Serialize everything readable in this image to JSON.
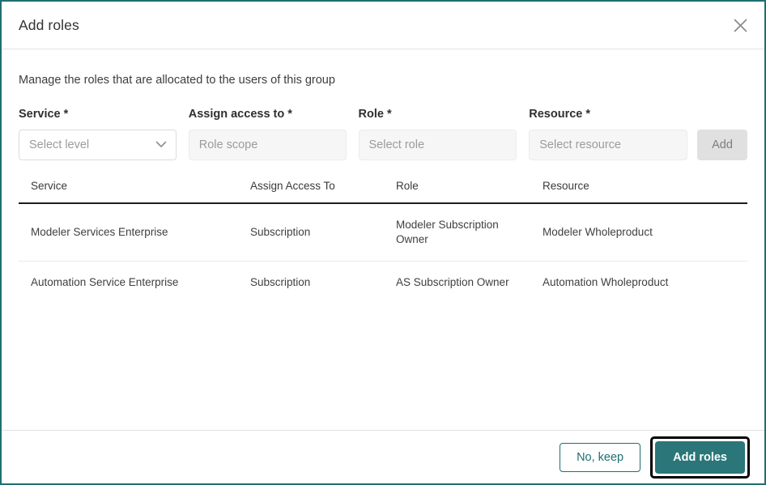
{
  "dialog": {
    "title": "Add roles",
    "close_icon": "close-icon",
    "intro": "Manage the roles that are allocated to the users of this group",
    "accent_color": "#1e6f72",
    "primary_button_color": "#2a7678"
  },
  "form": {
    "fields": [
      {
        "label": "Service *",
        "placeholder": "Select level",
        "type": "select",
        "disabled": false,
        "icon": "chevron-down-icon"
      },
      {
        "label": "Assign access to *",
        "placeholder": "Role scope",
        "type": "text",
        "disabled": true
      },
      {
        "label": "Role *",
        "placeholder": "Select role",
        "type": "select",
        "disabled": true
      },
      {
        "label": "Resource *",
        "placeholder": "Select resource",
        "type": "select",
        "disabled": true
      }
    ],
    "add_button": "Add"
  },
  "table": {
    "columns": [
      "Service",
      "Assign Access To",
      "Role",
      "Resource"
    ],
    "rows": [
      {
        "service": "Modeler Services Enterprise",
        "assign_access_to": "Subscription",
        "role": "Modeler Subscription Owner",
        "resource": "Modeler Wholeproduct"
      },
      {
        "service": "Automation Service Enterprise",
        "assign_access_to": "Subscription",
        "role": "AS Subscription Owner",
        "resource": "Automation Wholeproduct"
      }
    ]
  },
  "footer": {
    "cancel_label": "No, keep",
    "confirm_label": "Add roles"
  }
}
